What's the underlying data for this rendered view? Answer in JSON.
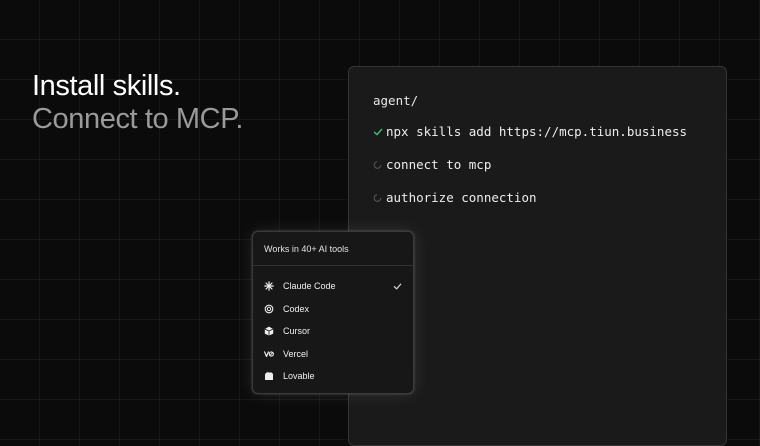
{
  "hero": {
    "line1": "Install skills.",
    "line2": "Connect to MCP."
  },
  "terminal": {
    "prompt": "agent/",
    "steps": [
      {
        "text": "npx skills add https://mcp.tiun.business",
        "status": "done"
      },
      {
        "text": "connect to mcp",
        "status": "pending"
      },
      {
        "text": "authorize connection",
        "status": "pending"
      }
    ]
  },
  "tools": {
    "header": "Works in 40+ AI tools",
    "items": [
      {
        "label": "Claude Code",
        "icon": "claude-icon",
        "selected": true
      },
      {
        "label": "Codex",
        "icon": "codex-icon",
        "selected": false
      },
      {
        "label": "Cursor",
        "icon": "cursor-icon",
        "selected": false
      },
      {
        "label": "Vercel",
        "icon": "vercel-icon",
        "selected": false
      },
      {
        "label": "Lovable",
        "icon": "lovable-icon",
        "selected": false
      }
    ]
  },
  "colors": {
    "background": "#0b0b0b",
    "panel": "#1a1a1a",
    "success": "#3fbf6a",
    "muted": "#9a9a9a"
  }
}
